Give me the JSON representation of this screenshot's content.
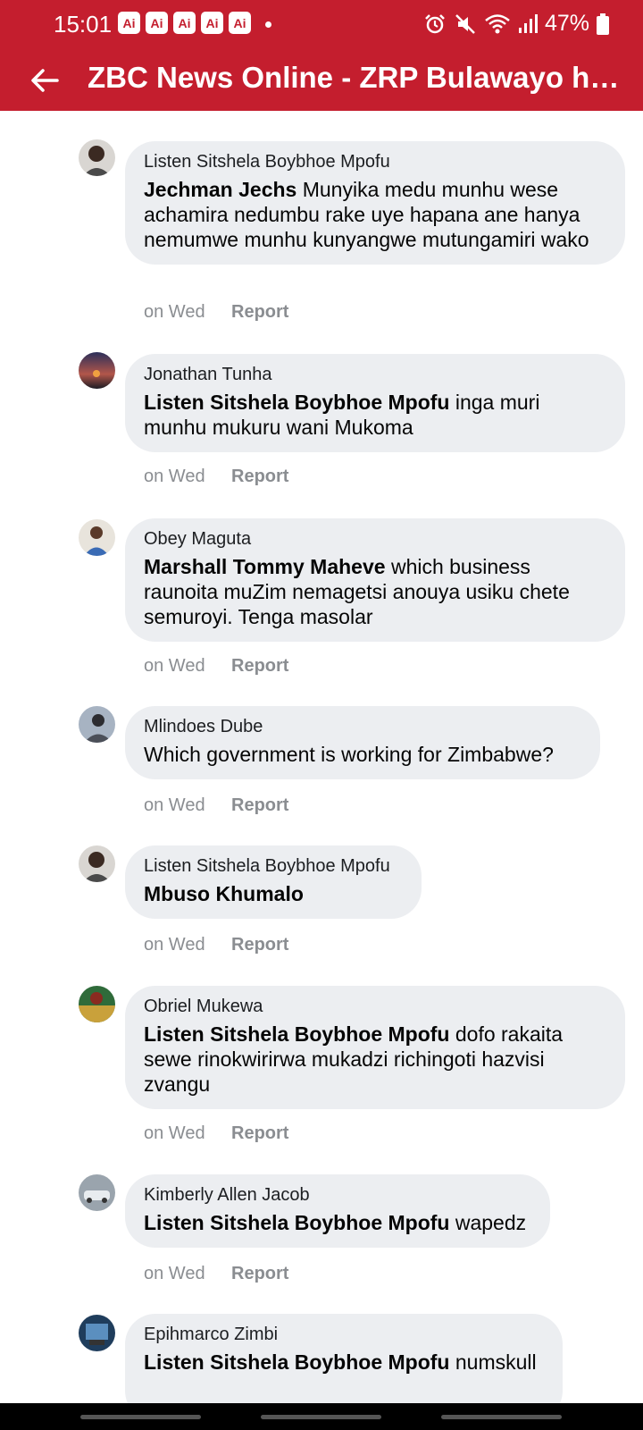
{
  "status_bar": {
    "time": "15:01",
    "ai_badges": [
      "Ai",
      "Ai",
      "Ai",
      "Ai",
      "Ai"
    ],
    "battery": "47%",
    "icons": [
      "alarm-icon",
      "mute-icon",
      "wifi-icon",
      "signal-icon",
      "battery-icon"
    ]
  },
  "app_bar": {
    "title": "ZBC News Online - ZRP Bulawayo ha…"
  },
  "comments": [
    {
      "author": "Listen Sitshela Boybhoe Mpofu",
      "mention": "Jechman Jechs",
      "text": " Munyika medu munhu wese achamira nedumbu rake uye hapana ane hanya nemumwe munhu kunyangwe mutungamiri wako",
      "time": "on Wed",
      "report": "Report"
    },
    {
      "author": "Jonathan Tunha",
      "mention": "Listen Sitshela Boybhoe Mpofu",
      "text": " inga muri munhu mukuru wani Mukoma",
      "time": "on Wed",
      "report": "Report"
    },
    {
      "author": "Obey Maguta",
      "mention": "Marshall Tommy Maheve",
      "text": " which business raunoita muZim nemagetsi anouya usiku chete semuroyi. Tenga masolar",
      "time": "on Wed",
      "report": "Report"
    },
    {
      "author": "Mlindoes Dube",
      "mention": "",
      "text": "Which government is working for Zimbabwe?",
      "time": "on Wed",
      "report": "Report"
    },
    {
      "author": "Listen Sitshela Boybhoe Mpofu",
      "mention": "Mbuso Khumalo",
      "text": "",
      "time": "on Wed",
      "report": "Report"
    },
    {
      "author": "Obriel Mukewa",
      "mention": "Listen Sitshela Boybhoe Mpofu",
      "text": " dofo rakaita sewe rinokwirirwa mukadzi richingoti hazvisi zvangu",
      "time": "on Wed",
      "report": "Report"
    },
    {
      "author": "Kimberly Allen Jacob",
      "mention": "Listen Sitshela Boybhoe Mpofu",
      "text": " wapedz",
      "time": "on Wed",
      "report": "Report"
    },
    {
      "author": "Epihmarco Zimbi",
      "mention": "Listen Sitshela Boybhoe Mpofu",
      "text": " numskull",
      "time": "",
      "report": ""
    }
  ],
  "colors": {
    "brand_red": "#c41e2e",
    "bubble_bg": "#eceef1",
    "meta_gray": "#8a8d91"
  }
}
